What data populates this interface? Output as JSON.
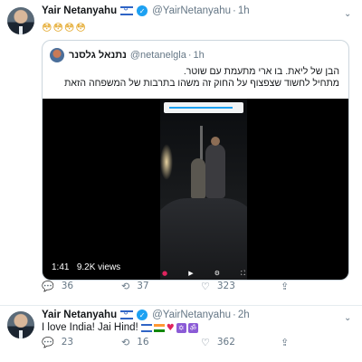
{
  "tweet1": {
    "author": {
      "name": "Yair Netanyahu",
      "handle": "@YairNetanyahu",
      "separator": "·",
      "time": "1h"
    },
    "text": "😳😳😳😳",
    "quote": {
      "author": {
        "name": "נתנאל גלסנר",
        "handle": "@netanelgla",
        "separator": "·",
        "time": "1h"
      },
      "text_line1": "הבן של ליאת. בו ארי מתעמת עם שוטר.",
      "text_line2": "מתחיל לחשוד שצפצוף על החוק זה משהו בתרבות של המשפחה הזאת",
      "video": {
        "duration": "1:41",
        "views": "9.2K views"
      }
    },
    "actions": {
      "replies": "36",
      "retweets": "37",
      "likes": "323"
    }
  },
  "tweet2": {
    "author": {
      "name": "Yair Netanyahu",
      "handle": "@YairNetanyahu",
      "separator": "·",
      "time": "2h"
    },
    "text": "I love India! Jai Hind!",
    "actions": {
      "replies": "23",
      "retweets": "16",
      "likes": "362"
    }
  },
  "icons": {
    "verified": "verified-badge-icon",
    "caret": "chevron-down-icon",
    "reply": "reply-icon",
    "retweet": "retweet-icon",
    "like": "heart-icon",
    "share": "share-icon"
  },
  "colors": {
    "accent": "#1da1f2",
    "muted": "#657786",
    "border": "#e6ecf0"
  }
}
